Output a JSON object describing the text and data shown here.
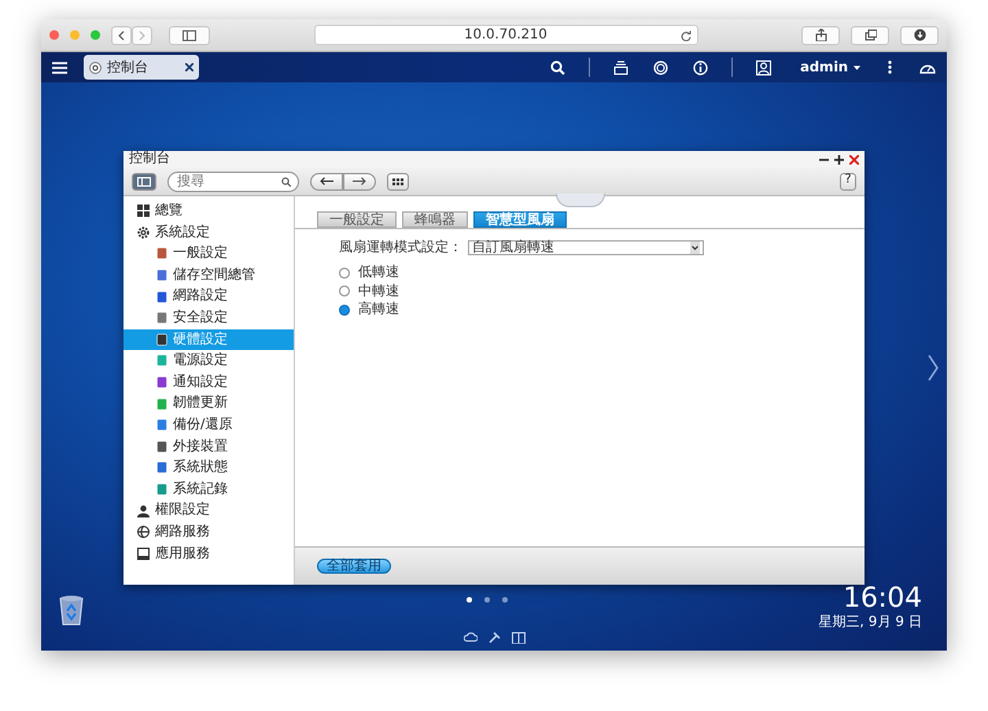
{
  "browser": {
    "url": "10.0.70.210"
  },
  "topbar": {
    "tab_title": "控制台",
    "user": "admin"
  },
  "window": {
    "title": "控制台",
    "search_placeholder": "搜尋",
    "sidebar": [
      {
        "label": "總覽",
        "selected": false
      },
      {
        "label": "系統設定",
        "selected": false,
        "children": [
          {
            "label": "一般設定",
            "selected": false
          },
          {
            "label": "儲存空間總管",
            "selected": false
          },
          {
            "label": "網路設定",
            "selected": false
          },
          {
            "label": "安全設定",
            "selected": false
          },
          {
            "label": "硬體設定",
            "selected": true
          },
          {
            "label": "電源設定",
            "selected": false
          },
          {
            "label": "通知設定",
            "selected": false
          },
          {
            "label": "韌體更新",
            "selected": false
          },
          {
            "label": "備份/還原",
            "selected": false
          },
          {
            "label": "外接裝置",
            "selected": false
          },
          {
            "label": "系統狀態",
            "selected": false
          },
          {
            "label": "系統記錄",
            "selected": false
          }
        ]
      },
      {
        "label": "權限設定",
        "selected": false
      },
      {
        "label": "網路服務",
        "selected": false
      },
      {
        "label": "應用服務",
        "selected": false
      }
    ],
    "tabs": [
      {
        "label": "一般設定",
        "selected": false
      },
      {
        "label": "蜂鳴器",
        "selected": false
      },
      {
        "label": "智慧型風扇",
        "selected": true
      }
    ],
    "form": {
      "label": "風扇運轉模式設定：",
      "select_value": "自訂風扇轉速",
      "options": [
        {
          "label": "低轉速",
          "selected": false
        },
        {
          "label": "中轉速",
          "selected": false
        },
        {
          "label": "高轉速",
          "selected": true
        }
      ]
    },
    "apply_button": "全部套用",
    "help_label": "?"
  },
  "desktop": {
    "page_dots": [
      {
        "selected": true
      },
      {
        "selected": false
      },
      {
        "selected": false
      }
    ],
    "clock": {
      "time": "16:04",
      "date": "星期三, 9月 9 日"
    }
  }
}
